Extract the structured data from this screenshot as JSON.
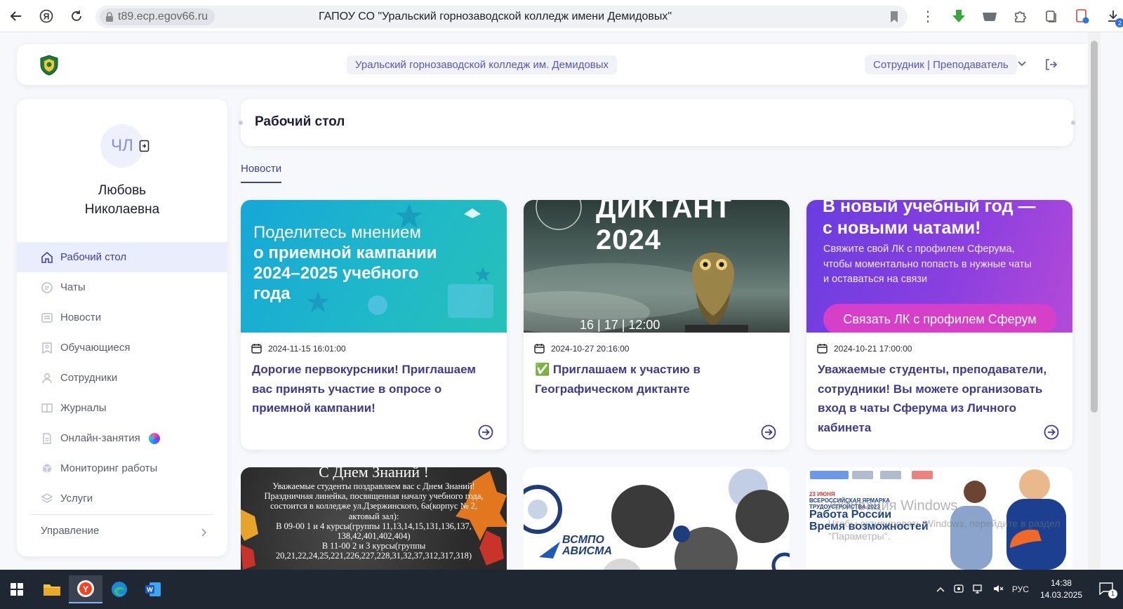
{
  "browser": {
    "url": "t89.ecp.egov66.ru",
    "tab_title": "ГАПОУ СО \"Уральский горнозаводской колледж имени Демидовых\"",
    "downloads_badge": "2"
  },
  "header": {
    "college_name": "Уральский горнозаводской колледж им. Демидовых",
    "role": "Сотрудник | Преподаватель"
  },
  "sidebar": {
    "avatar_initials": "ЧЛ",
    "user_name_line1": "Любовь",
    "user_name_line2": "Николаевна",
    "items": [
      {
        "label": "Рабочий стол",
        "icon": "home-icon",
        "active": true
      },
      {
        "label": "Чаты",
        "icon": "chat-icon"
      },
      {
        "label": "Новости",
        "icon": "news-icon"
      },
      {
        "label": "Обучающиеся",
        "icon": "students-icon"
      },
      {
        "label": "Сотрудники",
        "icon": "person-icon"
      },
      {
        "label": "Журналы",
        "icon": "book-icon"
      },
      {
        "label": "Онлайн-занятия",
        "icon": "document-icon"
      },
      {
        "label": "Мониторинг работы",
        "icon": "cube-icon"
      },
      {
        "label": "Услуги",
        "icon": "layers-icon"
      }
    ],
    "manage_label": "Управление"
  },
  "main": {
    "page_title": "Рабочий стол",
    "tabs": [
      {
        "label": "Новости"
      }
    ],
    "news": [
      {
        "date": "2024-11-15 16:01:00",
        "title": "Дорогие первокурсники! Приглашаем вас принять участие в опросе о приемной кампании!",
        "image_text": [
          "Поделитесь мнением",
          "о приемной кампании",
          "2024–2025 учебного",
          "года"
        ]
      },
      {
        "date": "2024-10-27 20:16:00",
        "title": "✅ Приглашаем к участию в Географическом диктанте",
        "image_text": [
          "ДИКТАНТ 2024",
          "16 | 17 | 12:00"
        ]
      },
      {
        "date": "2024-10-21 17:00:00",
        "title": "Уважаемые студенты, преподаватели, сотрудники! Вы можете организовать вход в чаты Сферума из Личного кабинета",
        "image_text": [
          "В новый учебный год —",
          "с новыми чатами!",
          "Свяжите свой ЛК с профилем Сферума,",
          "чтобы моментально попасть в нужные чаты",
          "и оставаться на связи",
          "Связать ЛК с профилем Сферум"
        ]
      }
    ],
    "news_row2": [
      {
        "image_text": [
          "С Днем Знаний !",
          "Уважаемые студенты поздравляем вас с Днем Знаний!",
          "Праздничная линейка, посвященная началу учебного года,",
          "состоится в колледже ул.Дзержинского, 6а(корпус № 2,",
          "актовый зал):",
          "В 09-00 1 и 4 курсы(группы 11,13,14,15,131,136,137,",
          "138,42,401,402,404)",
          "В 11-00 2 и 3 курсы(группы",
          "20,21,22,24,25,221,226,227,228,31,32,37,312,317,318)"
        ]
      },
      {
        "image_text": [
          "ВСМПО",
          "АВИСМА"
        ]
      },
      {
        "image_text": [
          "23 ИЮНЯ",
          "ВСЕРОССИЙСКАЯ ЯРМАРКА ТРУДОУСТРОЙСТВА 2023",
          "Работа России",
          "Время возможностей"
        ]
      }
    ]
  },
  "watermark": {
    "line1": "Активация Windows",
    "line2": "Чтобы активировать Windows, перейдите в раздел \"Параметры\"."
  },
  "taskbar": {
    "lang": "РУС",
    "time": "14:38",
    "date": "14.03.2025",
    "notifications": "1"
  }
}
